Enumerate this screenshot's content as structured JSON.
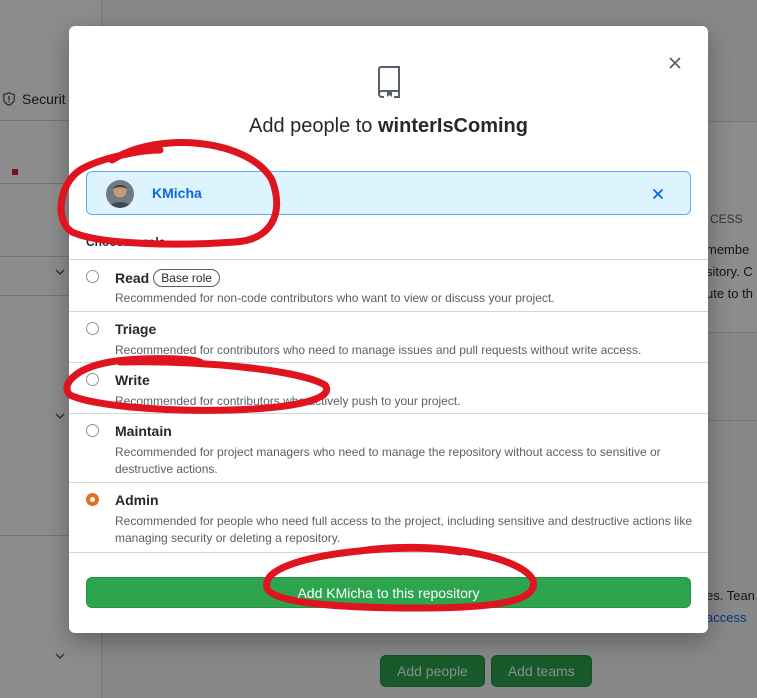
{
  "background": {
    "nav_security_label": "Securit",
    "right_text_1": "CESS",
    "right_text_2": "membe",
    "right_text_3": "sitory. C",
    "right_text_4": "ute to th",
    "right_text_5": "es. Tean",
    "right_link": "access",
    "add_people_label": "Add people",
    "add_teams_label": "Add teams"
  },
  "modal": {
    "title_prefix": "Add people to ",
    "repo_name": "winterIsComing",
    "selected_user": "KMicha",
    "role_heading": "Choose a role",
    "roles": [
      {
        "name": "Read",
        "badge": "Base role",
        "description": "Recommended for non-code contributors who want to view or discuss your project.",
        "selected": false
      },
      {
        "name": "Triage",
        "description": "Recommended for contributors who need to manage issues and pull requests without write access.",
        "selected": false
      },
      {
        "name": "Write",
        "description": "Recommended for contributors who actively push to your project.",
        "selected": false
      },
      {
        "name": "Maintain",
        "description": "Recommended for project managers who need to manage the repository without access to sensitive or destructive actions.",
        "selected": false
      },
      {
        "name": "Admin",
        "description": "Recommended for people who need full access to the project, including sensitive and destructive actions like managing security or deleting a repository.",
        "selected": true
      }
    ],
    "submit_label": "Add KMicha to this repository"
  },
  "colors": {
    "accent_green": "#2da44e",
    "link_blue": "#0969da",
    "selected_radio": "#e16f24",
    "annotation_red": "#e0141e"
  }
}
